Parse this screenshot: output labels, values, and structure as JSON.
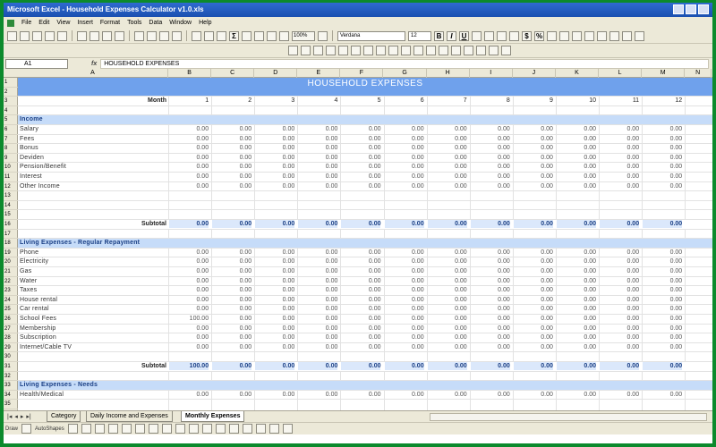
{
  "window": {
    "title": "Microsoft Excel - Household Expenses Calculator v1.0.xls"
  },
  "menu": [
    "File",
    "Edit",
    "View",
    "Insert",
    "Format",
    "Tools",
    "Data",
    "Window",
    "Help"
  ],
  "toolbar": {
    "zoom": "100%",
    "font": "Verdana",
    "font_size": "12",
    "bold": "B",
    "italic": "I",
    "underline": "U",
    "currency": "$",
    "percent": "%"
  },
  "formula_bar": {
    "cell_ref": "A1",
    "fx": "fx",
    "content": "HOUSEHOLD EXPENSES"
  },
  "columns": [
    "A",
    "B",
    "C",
    "D",
    "E",
    "F",
    "G",
    "H",
    "I",
    "J",
    "K",
    "L",
    "M",
    "N"
  ],
  "rows": [
    "1",
    "2",
    "3",
    "4",
    "5",
    "6",
    "7",
    "8",
    "9",
    "10",
    "11",
    "12",
    "13",
    "14",
    "15",
    "16",
    "17",
    "18",
    "19",
    "20",
    "21",
    "22",
    "23",
    "24",
    "25",
    "26",
    "27",
    "28",
    "29",
    "30",
    "31",
    "32",
    "33",
    "34",
    "35"
  ],
  "sheet": {
    "banner": "HOUSEHOLD EXPENSES",
    "month_label": "Month",
    "months": [
      "1",
      "2",
      "3",
      "4",
      "5",
      "6",
      "7",
      "8",
      "9",
      "10",
      "11",
      "12"
    ],
    "subtotal_label": "Subtotal",
    "income_header": "Income",
    "income_items": [
      "Salary",
      "Fees",
      "Bonus",
      "Deviden",
      "Pension/Benefit",
      "Interest",
      "Other Income"
    ],
    "living_regular_header": "Living Expenses - Regular Repayment",
    "living_regular_items": [
      "Phone",
      "Electricity",
      "Gas",
      "Water",
      "Taxes",
      "House rental",
      "Car rental",
      "School Fees",
      "Membership",
      "Subscription",
      "Internet/Cable TV"
    ],
    "school_fees_value": "100.00",
    "living_needs_header": "Living Expenses - Needs",
    "living_needs_items": [
      "Health/Medical"
    ],
    "zero": "0.00",
    "income_subtotal": "0.00",
    "regular_subtotal_first": "100.00"
  },
  "sheet_tabs": [
    {
      "label": "Category",
      "active": false
    },
    {
      "label": "Daily Income and Expenses",
      "active": false
    },
    {
      "label": "Monthly Expenses",
      "active": true
    }
  ],
  "draw_toolbar": {
    "draw": "Draw",
    "autoshapes": "AutoShapes"
  }
}
